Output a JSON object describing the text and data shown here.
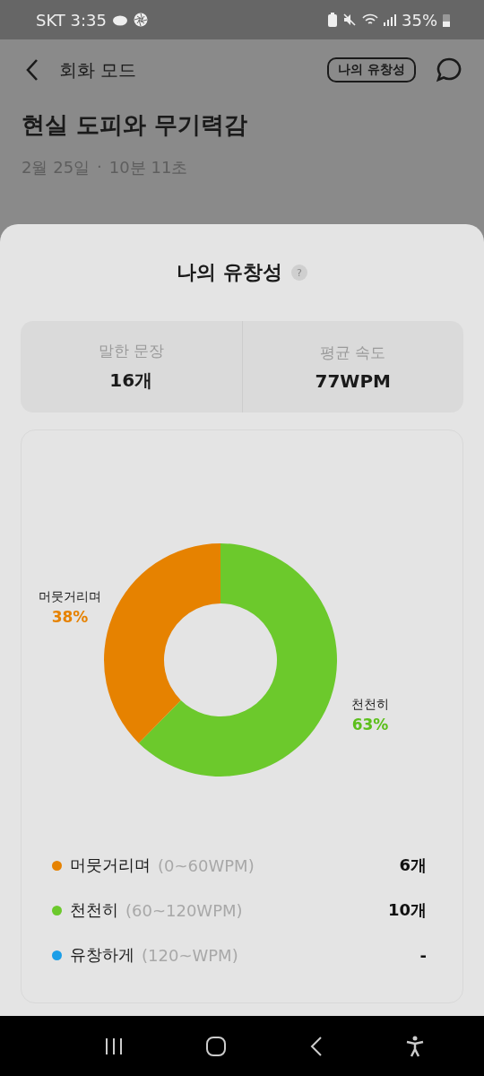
{
  "status_bar": {
    "carrier_time": "SKT 3:35",
    "battery": "35%"
  },
  "header": {
    "title": "회화 모드",
    "badge": "나의 유창성"
  },
  "session": {
    "title": "현실 도피와 무기력감",
    "date": "2월 25일",
    "separator": "·",
    "duration": "10분 11초"
  },
  "sheet": {
    "title": "나의 유창성",
    "help": "?",
    "stats": [
      {
        "label": "말한 문장",
        "value": "16개"
      },
      {
        "label": "평균 속도",
        "value": "77WPM"
      }
    ],
    "chart": {
      "chart_data": {
        "type": "donut",
        "categories": [
          "머뭇거리며",
          "천천히"
        ],
        "values": [
          38,
          63
        ],
        "value_labels": [
          "38%",
          "63%"
        ]
      }
    },
    "legend": [
      {
        "name": "머뭇거리며",
        "range": "(0~60WPM)",
        "count": "6개",
        "color": "#e68200"
      },
      {
        "name": "천천히",
        "range": "(60~120WPM)",
        "count": "10개",
        "color": "#6cc92c"
      },
      {
        "name": "유창하게",
        "range": "(120~WPM)",
        "count": "-",
        "color": "#1a9ee8"
      }
    ]
  }
}
